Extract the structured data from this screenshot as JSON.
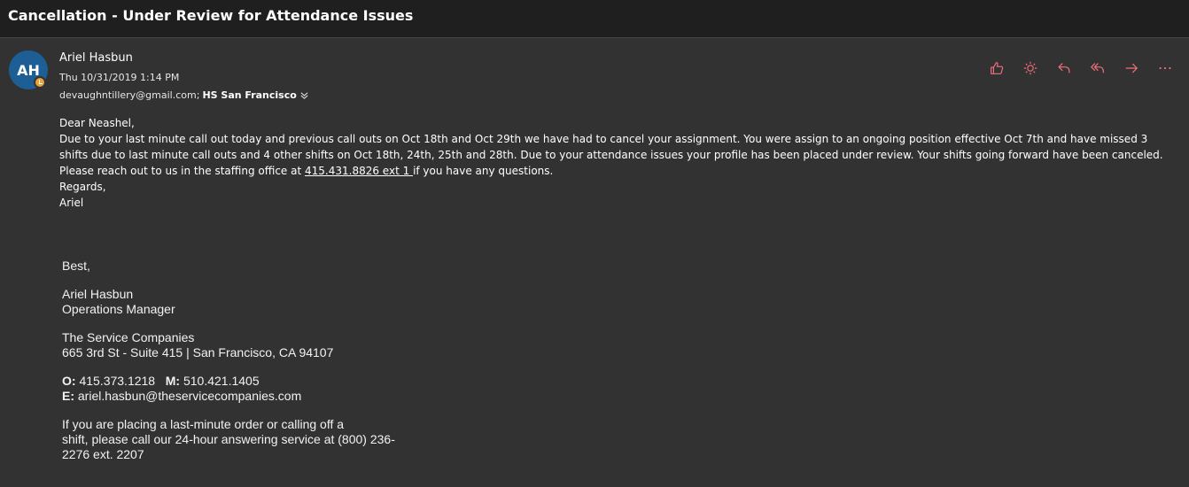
{
  "email": {
    "subject": "Cancellation - Under Review for Attendance Issues",
    "avatar_initials": "AH",
    "sender_name": "Ariel Hasbun",
    "date": "Thu 10/31/2019 1:14 PM",
    "recipient_1": "devaughntillery@gmail.com;",
    "recipient_2": "HS San Francisco"
  },
  "actions": [
    {
      "name": "like-button",
      "icon": "thumbs-up-icon"
    },
    {
      "name": "brightness-button",
      "icon": "sun-icon"
    },
    {
      "name": "reply-button",
      "icon": "reply-icon"
    },
    {
      "name": "reply-all-button",
      "icon": "reply-all-icon"
    },
    {
      "name": "forward-button",
      "icon": "forward-icon"
    },
    {
      "name": "more-button",
      "icon": "more-icon"
    }
  ],
  "body": {
    "greeting": "Dear Neashel,",
    "para1": "Due to your last minute call out today and previous call outs on Oct 18th and Oct 29th we have had to cancel your assignment.  You were assign to an ongoing position effective Oct 7th and have missed 3 shifts due to last minute call outs and 4 other shifts on Oct 18th, 24th, 25th and 28th.  Due to your attendance issues your profile has been placed under review. Your shifts going forward have been canceled.",
    "para2_pre": "Please reach out to us in the staffing office at ",
    "phone_link": "415.431.8826 ext 1 ",
    "para2_post": "if you have any questions.",
    "regards": "Regards,",
    "name": "Ariel"
  },
  "signature": {
    "closing": "Best,",
    "name": "Ariel Hasbun",
    "title": "Operations Manager",
    "company": "The Service Companies",
    "address": "665 3rd St - Suite 415 | San Francisco, CA 94107",
    "office_label": "O:",
    "office_phone": " 415.373.1218   ",
    "mobile_label": "M:",
    "mobile_phone": " 510.421.1405",
    "email_label": "E:",
    "email": " ariel.hasbun@theservicecompanies.com",
    "note_line1": "If you are placing a last-minute order or calling off a",
    "note_line2": "shift, please call our 24-hour answering service at (800) 236-",
    "note_line3": "2276 ext. 2207"
  },
  "colors": {
    "accent": "#f1707b",
    "avatar": "#1d5f95",
    "presence": "#e8a33d"
  }
}
